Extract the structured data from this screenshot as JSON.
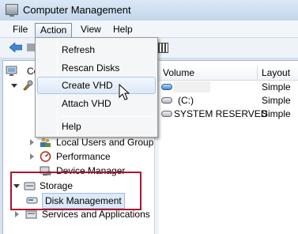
{
  "window": {
    "title": "Computer Management",
    "app_icon": "computer-management-icon"
  },
  "menubar": {
    "items": [
      "File",
      "Action",
      "View",
      "Help"
    ],
    "active": "Action"
  },
  "action_menu": {
    "items": [
      "Refresh",
      "Rescan Disks",
      "Create VHD",
      "Attach VHD",
      "Help"
    ],
    "hovered": "Create VHD"
  },
  "tree": {
    "items": [
      {
        "label": "Co",
        "icon": "computer-icon"
      },
      {
        "label": "",
        "icon": "tools-icon"
      },
      {
        "label": "Local Users and Groups",
        "icon": "users-icon"
      },
      {
        "label": "Performance",
        "icon": "performance-icon"
      },
      {
        "label": "Device Manager",
        "icon": "device-manager-icon"
      },
      {
        "label": "Storage",
        "icon": "storage-icon"
      },
      {
        "label": "Disk Management",
        "icon": "disk-management-icon",
        "selected": true
      },
      {
        "label": "Services and Applications",
        "icon": "services-icon"
      }
    ]
  },
  "list": {
    "columns": [
      "Volume",
      "Layout"
    ],
    "rows": [
      {
        "volume": "",
        "layout": "Simple",
        "icon": "blue-disk-icon"
      },
      {
        "volume": "(C:)",
        "layout": "Simple",
        "icon": "disk-icon"
      },
      {
        "volume": "SYSTEM RESERVED",
        "layout": "Simple",
        "icon": "disk-icon"
      }
    ]
  },
  "colors": {
    "highlight_border": "#b0122c",
    "menu_hover": "#dde9f7"
  }
}
